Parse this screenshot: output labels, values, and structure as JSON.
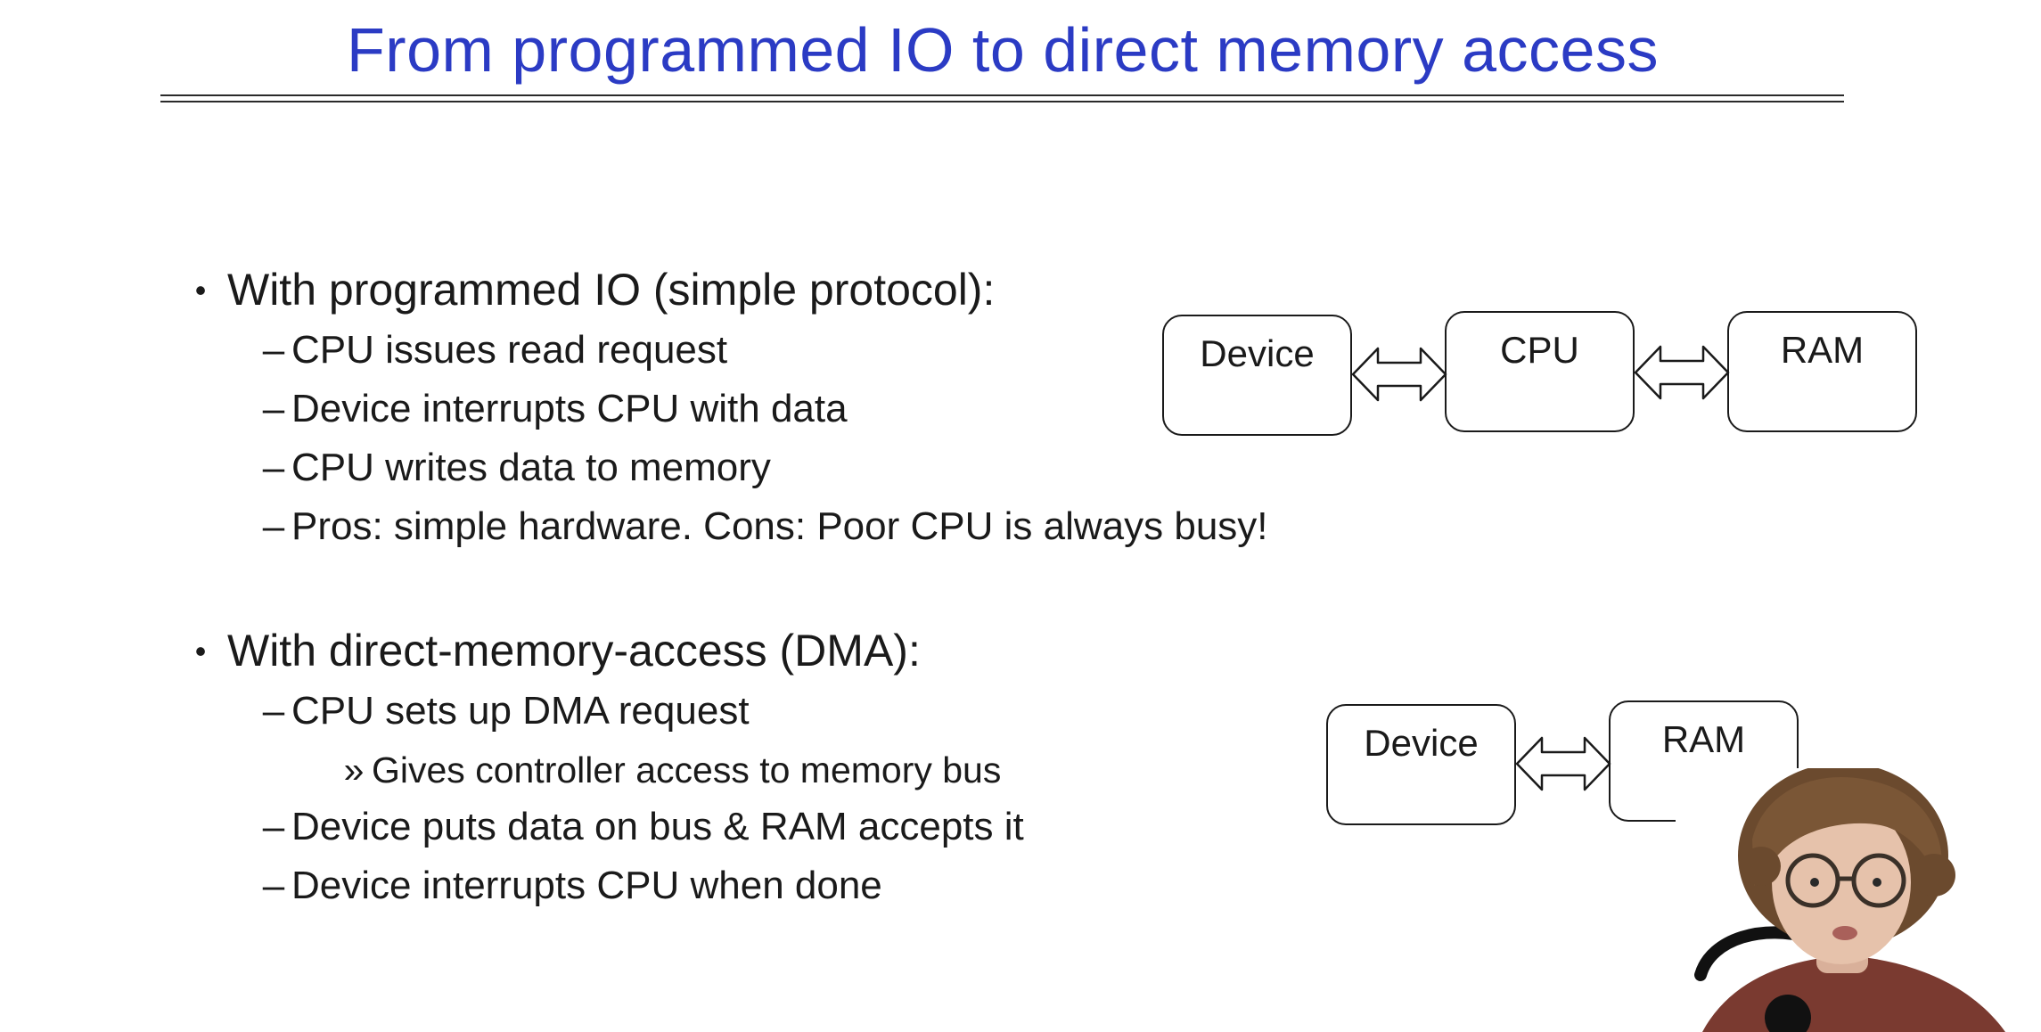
{
  "slide": {
    "title": "From programmed IO to direct memory access",
    "title_color": "#2b3bc4",
    "sections": [
      {
        "bullet": "•",
        "heading": "With programmed IO (simple protocol):",
        "items": [
          {
            "marker": "–",
            "text": "CPU issues read request"
          },
          {
            "marker": "–",
            "text": "Device interrupts CPU with data"
          },
          {
            "marker": "–",
            "text": "CPU writes data to memory"
          },
          {
            "marker": "–",
            "text": "Pros: simple hardware. Cons: Poor CPU is always busy!"
          }
        ]
      },
      {
        "bullet": "•",
        "heading": "With direct-memory-access (DMA):",
        "items": [
          {
            "marker": "–",
            "text": "CPU sets up DMA request"
          },
          {
            "marker": "»",
            "text": "Gives controller access to memory bus"
          },
          {
            "marker": "–",
            "text": "Device puts data on bus & RAM accepts it"
          },
          {
            "marker": "–",
            "text": "Device interrupts CPU when done"
          }
        ]
      }
    ]
  },
  "diagrams": {
    "programmed_io": {
      "boxes": [
        "Device",
        "CPU",
        "RAM"
      ],
      "arrows": "double-headed"
    },
    "dma": {
      "boxes": [
        "Device",
        "RAM"
      ],
      "arrows": "double-headed"
    }
  },
  "icons": [
    "double-arrow-icon",
    "speaker-webcam-video"
  ]
}
